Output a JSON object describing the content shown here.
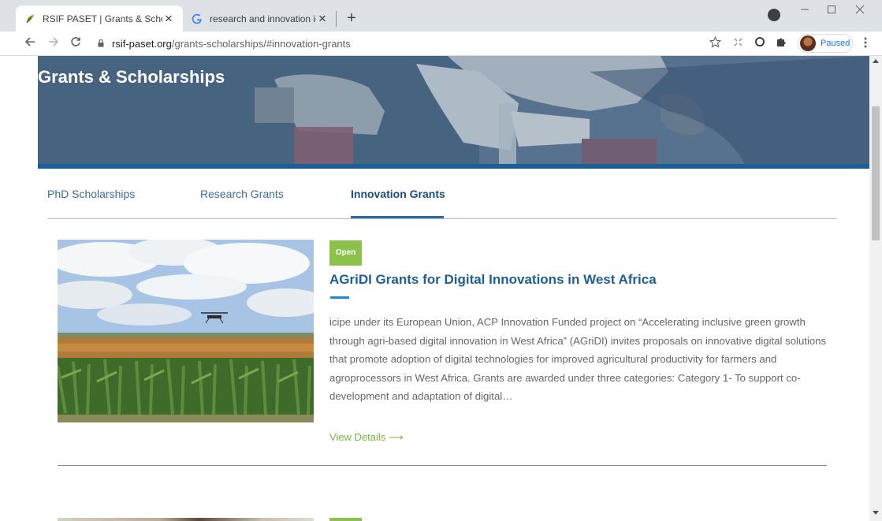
{
  "browser": {
    "tabs": [
      {
        "title": "RSIF PASET | Grants & Scholarshi",
        "favicon": "rsif-leaf-icon",
        "active": true
      },
      {
        "title": "research and innovation icon - G",
        "favicon": "google-g-icon",
        "active": false
      }
    ],
    "close_glyph": "✕",
    "new_tab_glyph": "+",
    "url_host": "rsif-paset.org",
    "url_path": "/grants-scholarships/#innovation-grants",
    "profile_status": "Paused"
  },
  "page": {
    "hero_title": "Grants & Scholarships",
    "tabs": [
      {
        "label": "PhD Scholarships",
        "active": false
      },
      {
        "label": "Research Grants",
        "active": false
      },
      {
        "label": "Innovation Grants",
        "active": true
      }
    ],
    "grants": [
      {
        "status": "Open",
        "title": "AGriDI Grants for Digital Innovations in West Africa",
        "description": "icipe under its European Union, ACP Innovation Funded project on “Accelerating inclusive green growth through agri-based digital innovation in West Africa” (AGriDI) invites  proposals on innovative digital solutions that promote adoption of digital technologies for improved agricultural productivity for farmers and agroprocessors in West Africa. Grants are awarded under three categories: Category 1- To support co-development and adaptation of digital…",
        "link_label": "View Details ⟶"
      }
    ]
  },
  "colors": {
    "brand_blue": "#1c5f94",
    "status_green": "#8bc34a",
    "link_green": "#7cb342"
  }
}
